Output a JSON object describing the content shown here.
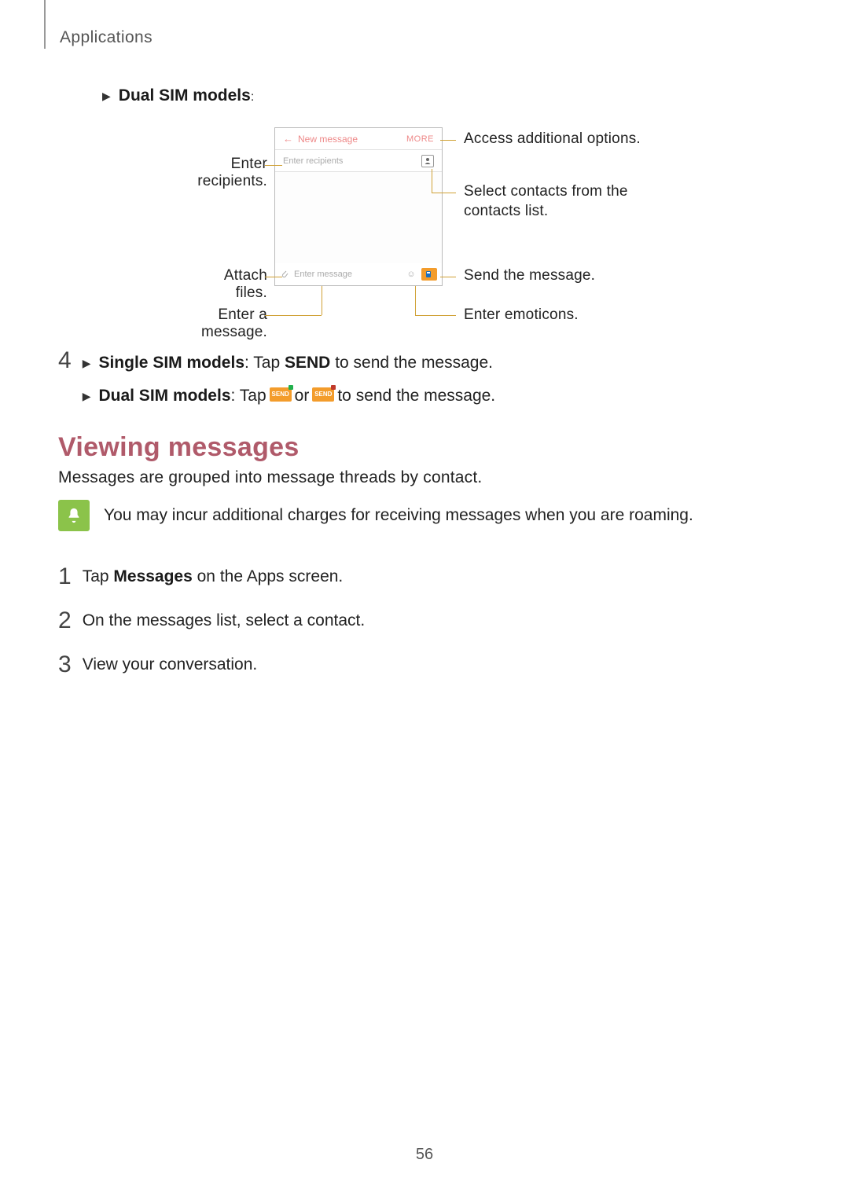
{
  "breadcrumb": "Applications",
  "bullets": {
    "dual_sim_heading": "Dual SIM models",
    "dual_sim_heading_colon": ":"
  },
  "mockup": {
    "title": "New message",
    "more": "MORE",
    "recipients_placeholder": "Enter recipients",
    "message_placeholder": "Enter message"
  },
  "callouts": {
    "enter_recipients": "Enter recipients.",
    "attach_files": "Attach files.",
    "enter_message": "Enter a message.",
    "access_options": "Access additional options.",
    "select_contacts_line1": "Select contacts from the",
    "select_contacts_line2": "contacts list.",
    "send_message": "Send the message.",
    "enter_emoticons": "Enter emoticons."
  },
  "step4": {
    "num": "4",
    "single_sim_label": "Single SIM models",
    "single_sim_text_a": ": Tap ",
    "single_sim_send": "SEND",
    "single_sim_text_b": " to send the message.",
    "dual_sim_label": "Dual SIM models",
    "dual_sim_text_a": ": Tap ",
    "dual_sim_or": " or ",
    "dual_sim_text_b": " to send the message.",
    "mini_send_label": "SEND"
  },
  "heading_viewing": "Viewing messages",
  "viewing_intro": "Messages are grouped into message threads by contact.",
  "note_text": "You may incur additional charges for receiving messages when you are roaming.",
  "ordered_steps": {
    "n1": "1",
    "n2": "2",
    "n3": "3",
    "s1_a": "Tap ",
    "s1_bold": "Messages",
    "s1_b": " on the Apps screen.",
    "s2": "On the messages list, select a contact.",
    "s3": "View your conversation."
  },
  "page_number": "56"
}
